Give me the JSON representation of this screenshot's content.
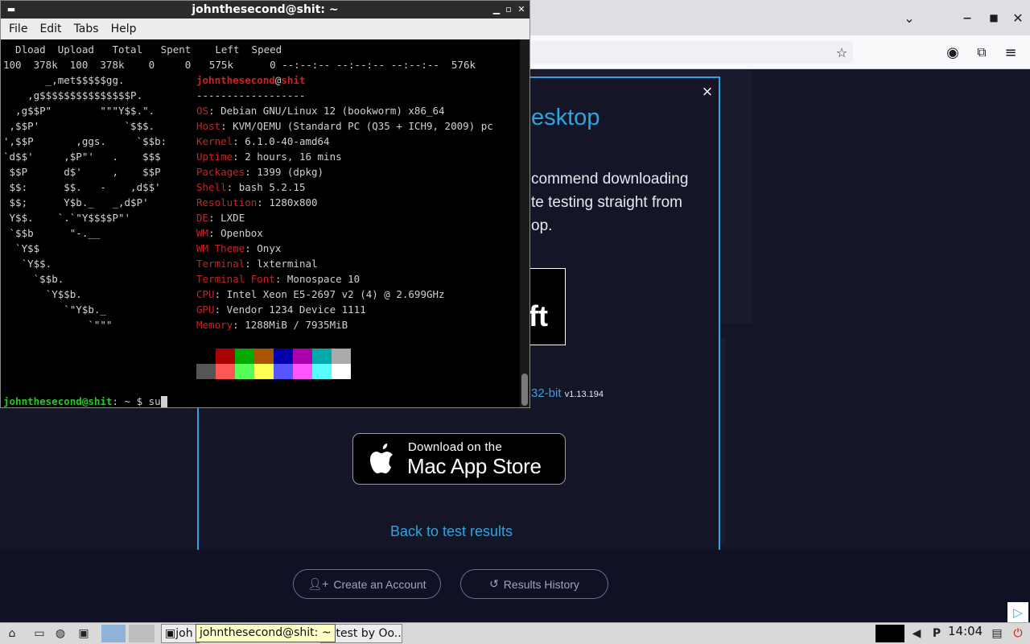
{
  "terminal": {
    "title": "johnthesecond@shit: ~",
    "menu": [
      "File",
      "Edit",
      "Tabs",
      "Help"
    ],
    "curl_header": "  Dload  Upload   Total   Spent    Left  Speed",
    "curl_progress": "100  378k  100  378k    0     0   575k      0 --:--:-- --:--:-- --:--:--  576k",
    "user": "johnthesecond",
    "host": "shit",
    "separator": "------------------",
    "info": [
      {
        "label": "OS",
        "value": "Debian GNU/Linux 12 (bookworm) x86_64"
      },
      {
        "label": "Host",
        "value": "KVM/QEMU (Standard PC (Q35 + ICH9, 2009) pc"
      },
      {
        "label": "Kernel",
        "value": "6.1.0-40-amd64"
      },
      {
        "label": "Uptime",
        "value": "2 hours, 16 mins"
      },
      {
        "label": "Packages",
        "value": "1399 (dpkg)"
      },
      {
        "label": "Shell",
        "value": "bash 5.2.15"
      },
      {
        "label": "Resolution",
        "value": "1280x800"
      },
      {
        "label": "DE",
        "value": "LXDE"
      },
      {
        "label": "WM",
        "value": "Openbox"
      },
      {
        "label": "WM Theme",
        "value": "Onyx"
      },
      {
        "label": "Terminal",
        "value": "lxterminal"
      },
      {
        "label": "Terminal Font",
        "value": "Monospace 10"
      },
      {
        "label": "CPU",
        "value": "Intel Xeon E5-2697 v2 (4) @ 2.699GHz"
      },
      {
        "label": "GPU",
        "value": "Vendor 1234 Device 1111"
      },
      {
        "label": "Memory",
        "value": "1288MiB / 7935MiB"
      }
    ],
    "logo": [
      "       _,met$$$$$gg.",
      "    ,g$$$$$$$$$$$$$$$P.",
      "  ,g$$P\"        \"\"\"Y$$.\".",
      " ,$$P'              `$$$.",
      "',$$P       ,ggs.     `$$b:",
      "`d$$'     ,$P\"'   .    $$$",
      " $$P      d$'     ,    $$P",
      " $$:      $$.   -    ,d$$'",
      " $$;      Y$b._   _,d$P'",
      " Y$$.    `.`\"Y$$$$P\"'",
      " `$$b      \"-.__",
      "  `Y$$",
      "   `Y$$.",
      "     `$$b.",
      "       `Y$$b.",
      "          `\"Y$b._",
      "              `\"\"\""
    ],
    "palette_top": [
      "#000000",
      "#aa0000",
      "#00aa00",
      "#aa5500",
      "#0000aa",
      "#aa00aa",
      "#00aaaa",
      "#aaaaaa"
    ],
    "palette_bottom": [
      "#555555",
      "#ff5555",
      "#55ff55",
      "#ffff55",
      "#5555ff",
      "#ff55ff",
      "#55ffff",
      "#ffffff"
    ],
    "prompt_user": "johnthesecond@shit",
    "prompt_path": ": ~",
    "prompt_symbol": " $ ",
    "typed": "su"
  },
  "browser": {
    "modal": {
      "title_fragment": "esktop",
      "text_lines": [
        "commend downloading",
        "te testing straight from",
        "op."
      ],
      "ms_fragment": "ft",
      "bit_link": "32-bit",
      "version": "v1.13.194",
      "appstore_line1": "Download on the",
      "appstore_line2": "Mac App Store",
      "back_link": "Back to test results",
      "close": "×"
    },
    "footer": {
      "create_account": "Create an Account",
      "results_history": "Results History"
    }
  },
  "taskbar": {
    "task_terminal": "joh",
    "task_browser": "edtest by Oo...",
    "tooltip": "johnthesecond@shit: ~",
    "clock": "14:04"
  }
}
